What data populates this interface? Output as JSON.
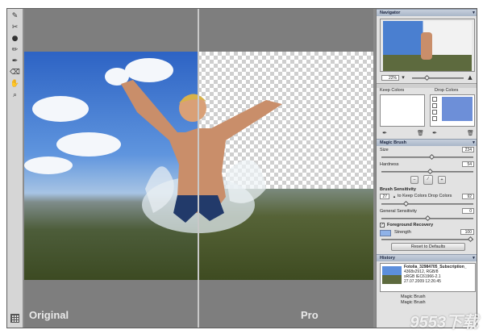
{
  "canvas": {
    "left_caption": "Original",
    "right_caption": "Pro"
  },
  "tools": [
    {
      "name": "magic-brush-icon",
      "glyph": "✎"
    },
    {
      "name": "keep-brush-icon",
      "glyph": "✂"
    },
    {
      "name": "drop-icon",
      "glyph": "●"
    },
    {
      "name": "pencil-icon",
      "glyph": "✏"
    },
    {
      "name": "eyedropper-icon",
      "glyph": "✒"
    },
    {
      "name": "eraser-icon",
      "glyph": "⌫"
    },
    {
      "name": "hand-icon",
      "glyph": "✋"
    },
    {
      "name": "zoom-icon",
      "glyph": "⌕"
    }
  ],
  "navigator": {
    "title": "Navigator",
    "zoom": "22%"
  },
  "colors": {
    "keep_label": "Keep Colors",
    "drop_label": "Drop Colors"
  },
  "magic_brush": {
    "title": "Magic Brush",
    "size_label": "Size",
    "size_value": "234",
    "hardness_label": "Hardness",
    "hardness_value": "54",
    "sensitivity_title": "Brush Sensitivity",
    "keep_value": "27",
    "to_keep_label": "to Keep Colors",
    "drop_colors_label": "Drop Colors",
    "drop_value": "92",
    "general_label": "General Sensitivity",
    "general_value": "0",
    "recovery_title": "Foreground Recovery",
    "strength_label": "Strength",
    "strength_value": "100",
    "reset_label": "Reset to Defaults"
  },
  "history": {
    "title": "History",
    "file_name": "Fotolia_32984705_Subscription_",
    "file_size": "4368x2912, RGB/8",
    "profile": "sRGB IEC61966-2.1",
    "date": "27.07.2009 12:26:45",
    "items": [
      "Magic Brush",
      "Magic Brush"
    ]
  },
  "watermark": "9553下载"
}
